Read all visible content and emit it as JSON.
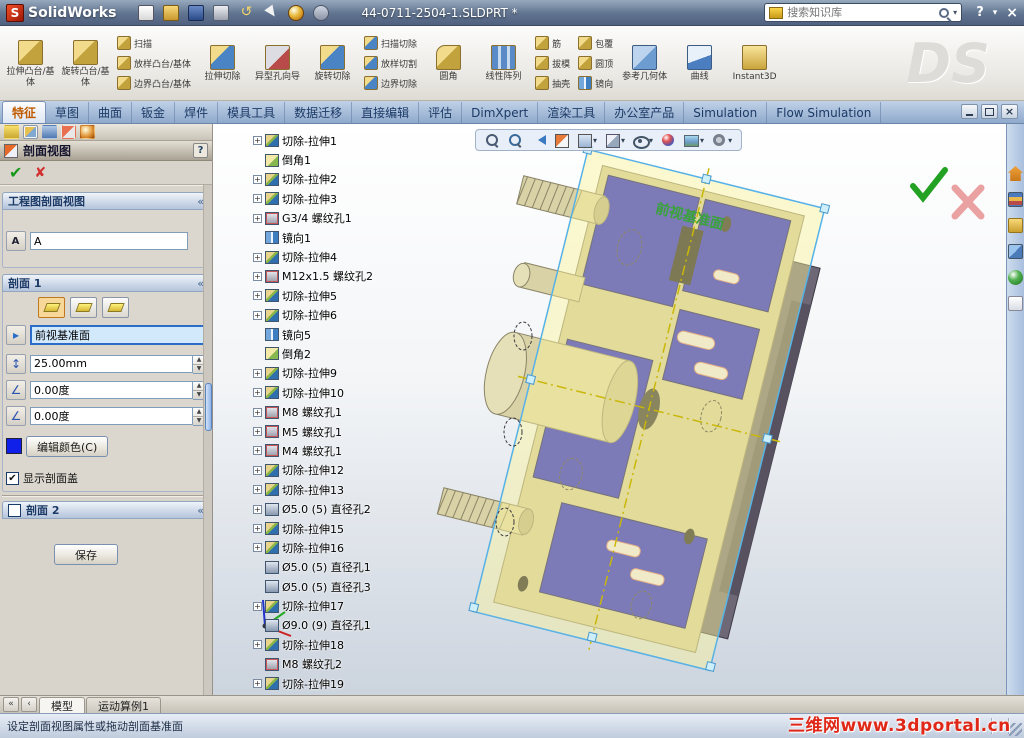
{
  "title_bar": {
    "app_name": "SolidWorks",
    "doc_title": "44-0711-2504-1.SLDPRT *",
    "search_placeholder": "搜索知识库",
    "help_label": "?",
    "quick_icons": [
      "new-document",
      "open",
      "save",
      "print",
      "undo",
      "select-arrow",
      "rebuild",
      "options"
    ]
  },
  "ds_logo": "DS",
  "toolbar": {
    "cells": [
      {
        "type": "large",
        "label": "拉伸凸台/基体",
        "icon": "extrude-boss"
      },
      {
        "type": "large",
        "label": "旋转凸台/基体",
        "icon": "revolve-boss"
      },
      {
        "type": "stack",
        "items": [
          {
            "label": "扫描",
            "icon": "sweep"
          },
          {
            "label": "放样凸台/基体",
            "icon": "loft"
          },
          {
            "label": "边界凸台/基体",
            "icon": "boundary"
          }
        ]
      },
      {
        "type": "large",
        "label": "拉伸切除",
        "icon": "extrude-cut"
      },
      {
        "type": "large",
        "label": "异型孔向导",
        "icon": "hole-wizard"
      },
      {
        "type": "large",
        "label": "旋转切除",
        "icon": "revolve-cut"
      },
      {
        "type": "stack",
        "items": [
          {
            "label": "扫描切除",
            "icon": "sweep-cut"
          },
          {
            "label": "放样切割",
            "icon": "loft-cut"
          },
          {
            "label": "边界切除",
            "icon": "boundary-cut"
          }
        ]
      },
      {
        "type": "large",
        "label": "圆角",
        "icon": "fillet"
      },
      {
        "type": "large",
        "label": "线性阵列",
        "icon": "linear-pattern"
      },
      {
        "type": "stack",
        "items": [
          {
            "label": "筋",
            "icon": "rib"
          },
          {
            "label": "拔模",
            "icon": "draft"
          },
          {
            "label": "抽壳",
            "icon": "shell"
          }
        ]
      },
      {
        "type": "stack",
        "items": [
          {
            "label": "包覆",
            "icon": "wrap"
          },
          {
            "label": "圆顶",
            "icon": "dome"
          },
          {
            "label": "镜向",
            "icon": "mirror"
          }
        ]
      },
      {
        "type": "large",
        "label": "参考几何体",
        "icon": "reference-geometry"
      },
      {
        "type": "large",
        "label": "曲线",
        "icon": "curves"
      },
      {
        "type": "large",
        "label": "Instant3D",
        "icon": "instant3d"
      }
    ]
  },
  "ribbon_tabs": {
    "items": [
      {
        "label": "特征",
        "active": true
      },
      {
        "label": "草图",
        "active": false
      },
      {
        "label": "曲面",
        "active": false
      },
      {
        "label": "钣金",
        "active": false
      },
      {
        "label": "焊件",
        "active": false
      },
      {
        "label": "模具工具",
        "active": false
      },
      {
        "label": "数据迁移",
        "active": false
      },
      {
        "label": "直接编辑",
        "active": false
      },
      {
        "label": "评估",
        "active": false
      },
      {
        "label": "DimXpert",
        "active": false
      },
      {
        "label": "渲染工具",
        "active": false
      },
      {
        "label": "办公室产品",
        "active": false
      },
      {
        "label": "Simulation",
        "active": false
      },
      {
        "label": "Flow Simulation",
        "active": false
      }
    ]
  },
  "property_panel": {
    "tab_icons": [
      "feature-manager",
      "property-manager",
      "configuration-manager",
      "dimxpert-manager",
      "display-manager"
    ],
    "title": "剖面视图",
    "help_label": "?",
    "drawing_section": {
      "header": "工程图剖面视图",
      "label_value": "A"
    },
    "section1": {
      "header": "剖面 1",
      "plane": "前视基准面",
      "offset": "25.00mm",
      "angle1": "0.00度",
      "angle2": "0.00度",
      "color": "#1020e8",
      "edit_color_label": "编辑颜色(C)",
      "show_cap_label": "显示剖面盖",
      "show_cap_checked": true
    },
    "section2": {
      "header": "剖面 2"
    },
    "save_label": "保存"
  },
  "feature_tree": {
    "items": [
      {
        "label": "切除-拉伸1",
        "icon": "cut",
        "expand": true
      },
      {
        "label": "倒角1",
        "icon": "chamfer",
        "expand": false
      },
      {
        "label": "切除-拉伸2",
        "icon": "cut",
        "expand": true
      },
      {
        "label": "切除-拉伸3",
        "icon": "cut",
        "expand": true
      },
      {
        "label": "G3/4 螺纹孔1",
        "icon": "thread",
        "expand": true
      },
      {
        "label": "镜向1",
        "icon": "mirror",
        "expand": false
      },
      {
        "label": "切除-拉伸4",
        "icon": "cut",
        "expand": true
      },
      {
        "label": "M12x1.5 螺纹孔2",
        "icon": "thread",
        "expand": true
      },
      {
        "label": "切除-拉伸5",
        "icon": "cut",
        "expand": true
      },
      {
        "label": "切除-拉伸6",
        "icon": "cut",
        "expand": true
      },
      {
        "label": "镜向5",
        "icon": "mirror",
        "expand": false
      },
      {
        "label": "倒角2",
        "icon": "chamfer",
        "expand": false
      },
      {
        "label": "切除-拉伸9",
        "icon": "cut",
        "expand": true
      },
      {
        "label": "切除-拉伸10",
        "icon": "cut",
        "expand": true
      },
      {
        "label": "M8 螺纹孔1",
        "icon": "thread",
        "expand": true
      },
      {
        "label": "M5 螺纹孔1",
        "icon": "thread",
        "expand": true
      },
      {
        "label": "M4 螺纹孔1",
        "icon": "thread",
        "expand": true
      },
      {
        "label": "切除-拉伸12",
        "icon": "cut",
        "expand": true
      },
      {
        "label": "切除-拉伸13",
        "icon": "cut",
        "expand": true
      },
      {
        "label": "Ø5.0 (5) 直径孔2",
        "icon": "hole",
        "expand": true
      },
      {
        "label": "切除-拉伸15",
        "icon": "cut",
        "expand": true
      },
      {
        "label": "切除-拉伸16",
        "icon": "cut",
        "expand": true
      },
      {
        "label": "Ø5.0 (5) 直径孔1",
        "icon": "hole",
        "expand": false
      },
      {
        "label": "Ø5.0 (5) 直径孔3",
        "icon": "hole",
        "expand": false
      },
      {
        "label": "切除-拉伸17",
        "icon": "cut",
        "expand": true
      },
      {
        "label": "Ø9.0 (9) 直径孔1",
        "icon": "hole",
        "expand": false
      },
      {
        "label": "切除-拉伸18",
        "icon": "cut",
        "expand": true
      },
      {
        "label": "M8 螺纹孔2",
        "icon": "thread",
        "expand": false
      },
      {
        "label": "切除-拉伸19",
        "icon": "cut",
        "expand": true
      }
    ]
  },
  "viewport": {
    "plane_label": "前视基准面",
    "hud_icons": [
      "zoom-fit",
      "zoom-area",
      "previous-view",
      "section-view",
      "view-orientation",
      "display-style",
      "hide-show",
      "appearance",
      "scene",
      "view-settings"
    ]
  },
  "task_pane": {
    "icons": [
      "home",
      "design-library",
      "file-explorer",
      "view-palette",
      "appearances",
      "custom-properties"
    ]
  },
  "bottom_bar": {
    "scroll_first": "«",
    "scroll_prev": "‹",
    "tabs": [
      {
        "label": "模型",
        "active": true
      },
      {
        "label": "运动算例1",
        "active": false
      }
    ]
  },
  "status_bar": {
    "text": "设定剖面视图属性或拖动剖面基准面"
  },
  "watermark": "三维网www.3dportal.cn"
}
